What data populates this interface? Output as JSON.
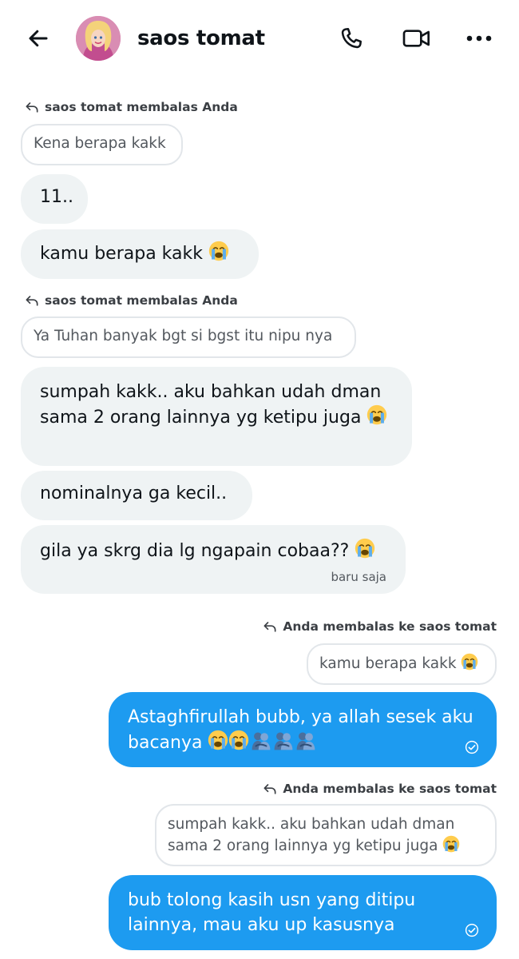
{
  "header": {
    "contact_name": "saos tomat",
    "back_icon": "arrow-left-icon",
    "call_icon": "phone-icon",
    "video_icon": "video-camera-icon",
    "more_icon": "more-horizontal-icon"
  },
  "messages": [
    {
      "reply_label": "saos tomat membalas Anda",
      "quoted_text": "Kena berapa kakk"
    },
    {
      "text": "11.."
    },
    {
      "text": "kamu berapa kakk",
      "emoji": "loudly-crying-face"
    },
    {
      "reply_label": "saos tomat membalas Anda",
      "quoted_text": "Ya Tuhan banyak bgt si bgst itu nipu nya"
    },
    {
      "text": "sumpah kakk.. aku bahkan udah dman sama 2 orang lainnya yg ketipu juga",
      "emoji": "loudly-crying-face"
    },
    {
      "text": "nominalnya ga kecil.."
    },
    {
      "text": "gila ya skrg dia lg ngapain cobaa??",
      "emoji": "loudly-crying-face",
      "timestamp": "baru saja"
    },
    {
      "reply_label": "Anda membalas ke saos tomat",
      "quoted_text": "kamu berapa kakk",
      "quoted_emoji": "loudly-crying-face"
    },
    {
      "text": "Astaghfirullah bubb, ya allah sesek aku bacanya",
      "emojis": [
        "loudly-crying-face",
        "loudly-crying-face",
        "people-hugging",
        "people-hugging",
        "people-hugging"
      ],
      "status_icon": "read-check-icon"
    },
    {
      "reply_label": "Anda membalas ke saos tomat",
      "quoted_text": "sumpah kakk.. aku bahkan udah dman sama 2 orang lainnya yg ketipu juga",
      "quoted_emoji": "loudly-crying-face"
    },
    {
      "text": "bub tolong kasih usn yang ditipu lainnya, mau aku up kasusnya",
      "status_icon": "read-check-icon"
    }
  ],
  "colors": {
    "outgoing_bubble": "#1d9bf0",
    "incoming_bubble": "#eff3f4",
    "quote_border": "#e2e6ea"
  }
}
